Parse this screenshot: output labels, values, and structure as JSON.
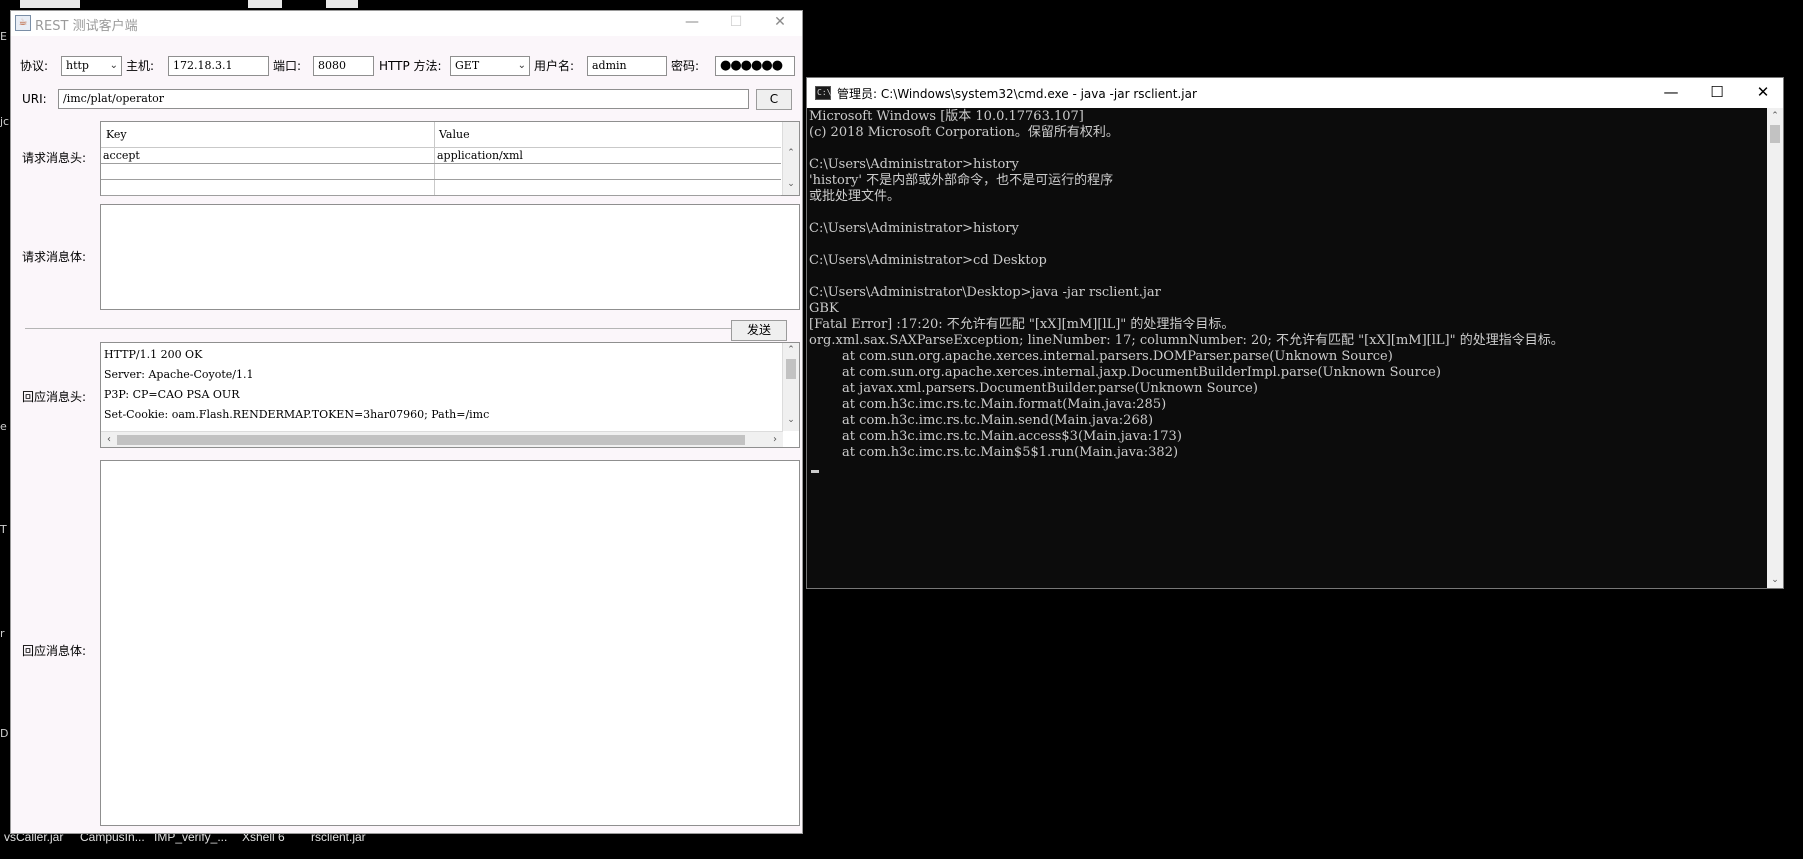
{
  "desktop": {
    "edge_fragments": [
      "E",
      "jc",
      "e",
      "T",
      "r",
      "D"
    ],
    "taskbar_labels": [
      "vsCaller.jar",
      "CampusIn...",
      "IMP_verify_...",
      "Xshell 6",
      "rsclient.jar"
    ]
  },
  "rest_client": {
    "title": "REST 测试客户端",
    "icon": "java-cup-icon",
    "controls": {
      "minimize": "—",
      "maximize": "☐",
      "close": "✕"
    },
    "protocol_label": "协议:",
    "protocol_value": "http",
    "host_label": "主机:",
    "host_value": "172.18.3.1",
    "port_label": "端口:",
    "port_value": "8080",
    "method_label": "HTTP 方法:",
    "method_value": "GET",
    "username_label": "用户名:",
    "username_value": "admin",
    "password_label": "密码:",
    "password_value": "●●●●●●",
    "uri_label": "URI:",
    "uri_value": "/imc/plat/operator",
    "uri_button": "C",
    "request_headers_label": "请求消息头:",
    "headers_table": {
      "columns": [
        "Key",
        "Value"
      ],
      "rows": [
        {
          "key": "accept",
          "value": "application/xml"
        },
        {
          "key": "",
          "value": ""
        },
        {
          "key": "",
          "value": ""
        }
      ]
    },
    "request_body_label": "请求消息体:",
    "send_button": "发送",
    "response_headers_label": "回应消息头:",
    "response_headers": [
      "HTTP/1.1 200 OK",
      "Server: Apache-Coyote/1.1",
      "P3P: CP=CAO PSA OUR",
      "Set-Cookie: oam.Flash.RENDERMAP.TOKEN=3har07960; Path=/imc"
    ],
    "response_body_label": "回应消息体:"
  },
  "cmd": {
    "title": "管理员: C:\\Windows\\system32\\cmd.exe - java  -jar rsclient.jar",
    "controls": {
      "minimize": "—",
      "maximize": "☐",
      "close": "✕"
    },
    "lines": [
      "Microsoft Windows [版本 10.0.17763.107]",
      "(c) 2018 Microsoft Corporation。保留所有权利。",
      "",
      "C:\\Users\\Administrator>history",
      "'history' 不是内部或外部命令，也不是可运行的程序",
      "或批处理文件。",
      "",
      "C:\\Users\\Administrator>history",
      "",
      "C:\\Users\\Administrator>cd Desktop",
      "",
      "C:\\Users\\Administrator\\Desktop>java -jar rsclient.jar",
      "GBK",
      "[Fatal Error] :17:20: 不允许有匹配 \"[xX][mM][lL]\" 的处理指令目标。",
      "org.xml.sax.SAXParseException; lineNumber: 17; columnNumber: 20; 不允许有匹配 \"[xX][mM][lL]\" 的处理指令目标。",
      "        at com.sun.org.apache.xerces.internal.parsers.DOMParser.parse(Unknown Source)",
      "        at com.sun.org.apache.xerces.internal.jaxp.DocumentBuilderImpl.parse(Unknown Source)",
      "        at javax.xml.parsers.DocumentBuilder.parse(Unknown Source)",
      "        at com.h3c.imc.rs.tc.Main.format(Main.java:285)",
      "        at com.h3c.imc.rs.tc.Main.send(Main.java:268)",
      "        at com.h3c.imc.rs.tc.Main.access$3(Main.java:173)",
      "        at com.h3c.imc.rs.tc.Main$5$1.run(Main.java:382)"
    ]
  }
}
